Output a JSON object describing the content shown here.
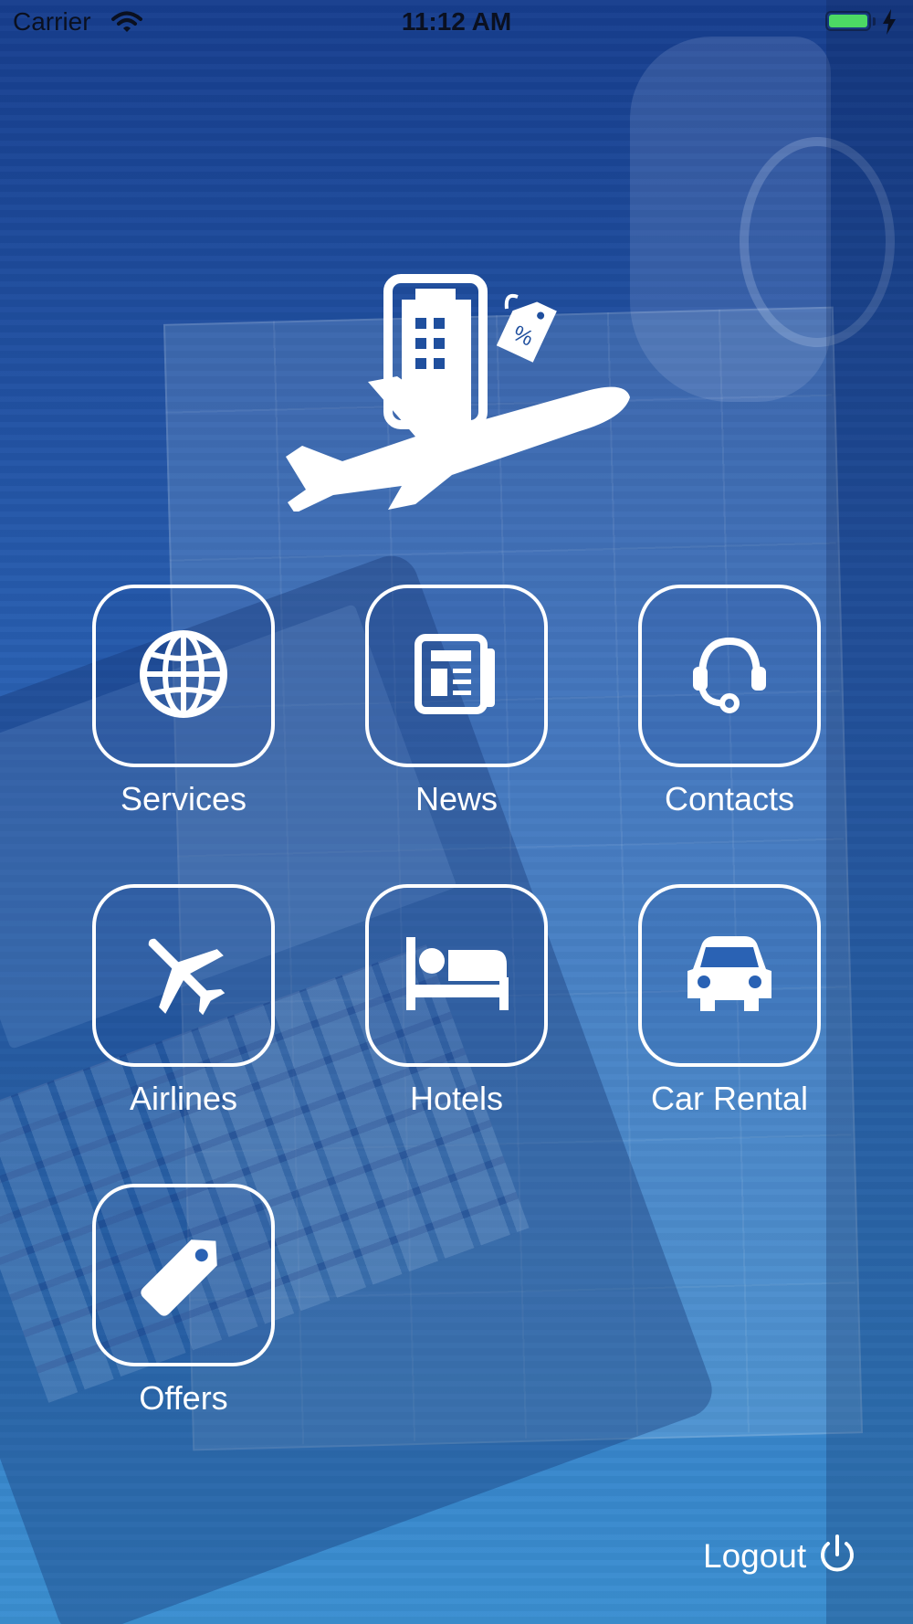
{
  "status_bar": {
    "carrier": "Carrier",
    "time": "11:12 AM",
    "battery_color": "#4cd964",
    "icons": [
      "wifi-icon",
      "battery-icon",
      "charging-bolt-icon"
    ]
  },
  "logo": {
    "icon": "plane-hotel-discount-logo"
  },
  "menu": {
    "items": [
      {
        "label": "Services",
        "icon": "globe-icon"
      },
      {
        "label": "News",
        "icon": "newspaper-icon"
      },
      {
        "label": "Contacts",
        "icon": "headset-icon"
      },
      {
        "label": "Airlines",
        "icon": "airplane-icon"
      },
      {
        "label": "Hotels",
        "icon": "bed-icon"
      },
      {
        "label": "Car Rental",
        "icon": "car-icon"
      },
      {
        "label": "Offers",
        "icon": "price-tag-icon"
      }
    ]
  },
  "logout": {
    "label": "Logout",
    "icon": "power-icon"
  },
  "colors": {
    "background_top": "#173e8e",
    "background_bottom": "#3b8fd1",
    "foreground": "#ffffff"
  }
}
